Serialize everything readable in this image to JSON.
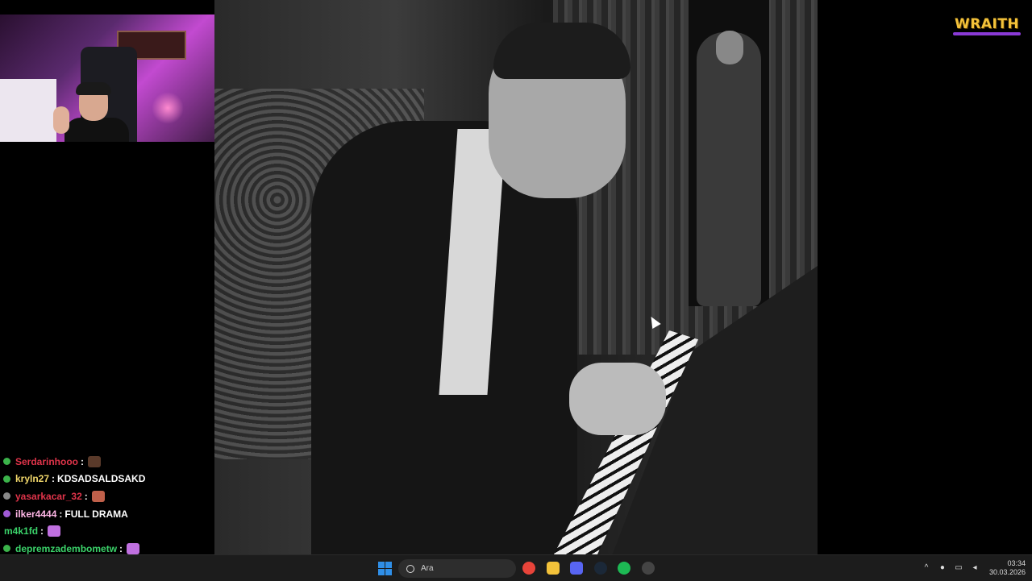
{
  "overlay": {
    "logo_text": "WRAITH"
  },
  "chat": {
    "messages": [
      {
        "user": "Serdarinhooo",
        "message": "",
        "user_color": "#e0344a",
        "badge_color": "#3bb34a",
        "emote": true,
        "emote_color": "#5a3a2a"
      },
      {
        "user": "kryln27",
        "message": "KDSADSALDSAKD",
        "user_color": "#f0d66a",
        "badge_color": "#3bb34a",
        "emote": false
      },
      {
        "user": "yasarkacar_32",
        "message": "",
        "user_color": "#e0344a",
        "badge_color": "#888888",
        "emote": true,
        "emote_color": "#c0604a"
      },
      {
        "user": "ilker4444",
        "message": "FULL DRAMA",
        "user_color": "#ffb6e6",
        "badge_color": "#a05ad6",
        "emote": false
      },
      {
        "user": "m4k1fd",
        "message": "",
        "user_color": "#3bd36a",
        "badge_color": "",
        "emote": true,
        "emote_color": "#c070e0"
      },
      {
        "user": "depremzadembometw",
        "message": "",
        "user_color": "#3bd36a",
        "badge_color": "#3bb34a",
        "emote": true,
        "emote_color": "#c070e0"
      }
    ]
  },
  "taskbar": {
    "search_placeholder": "Ara",
    "apps": [
      {
        "name": "chrome-icon",
        "color": "#e8443a"
      },
      {
        "name": "file-explorer-icon",
        "color": "#f3c23a"
      },
      {
        "name": "discord-icon",
        "color": "#5865f2"
      },
      {
        "name": "steam-icon",
        "color": "#1b2838"
      },
      {
        "name": "spotify-icon",
        "color": "#1db954"
      },
      {
        "name": "obs-icon",
        "color": "#444444"
      }
    ],
    "time": "03:34",
    "date": "30.03.2026"
  }
}
